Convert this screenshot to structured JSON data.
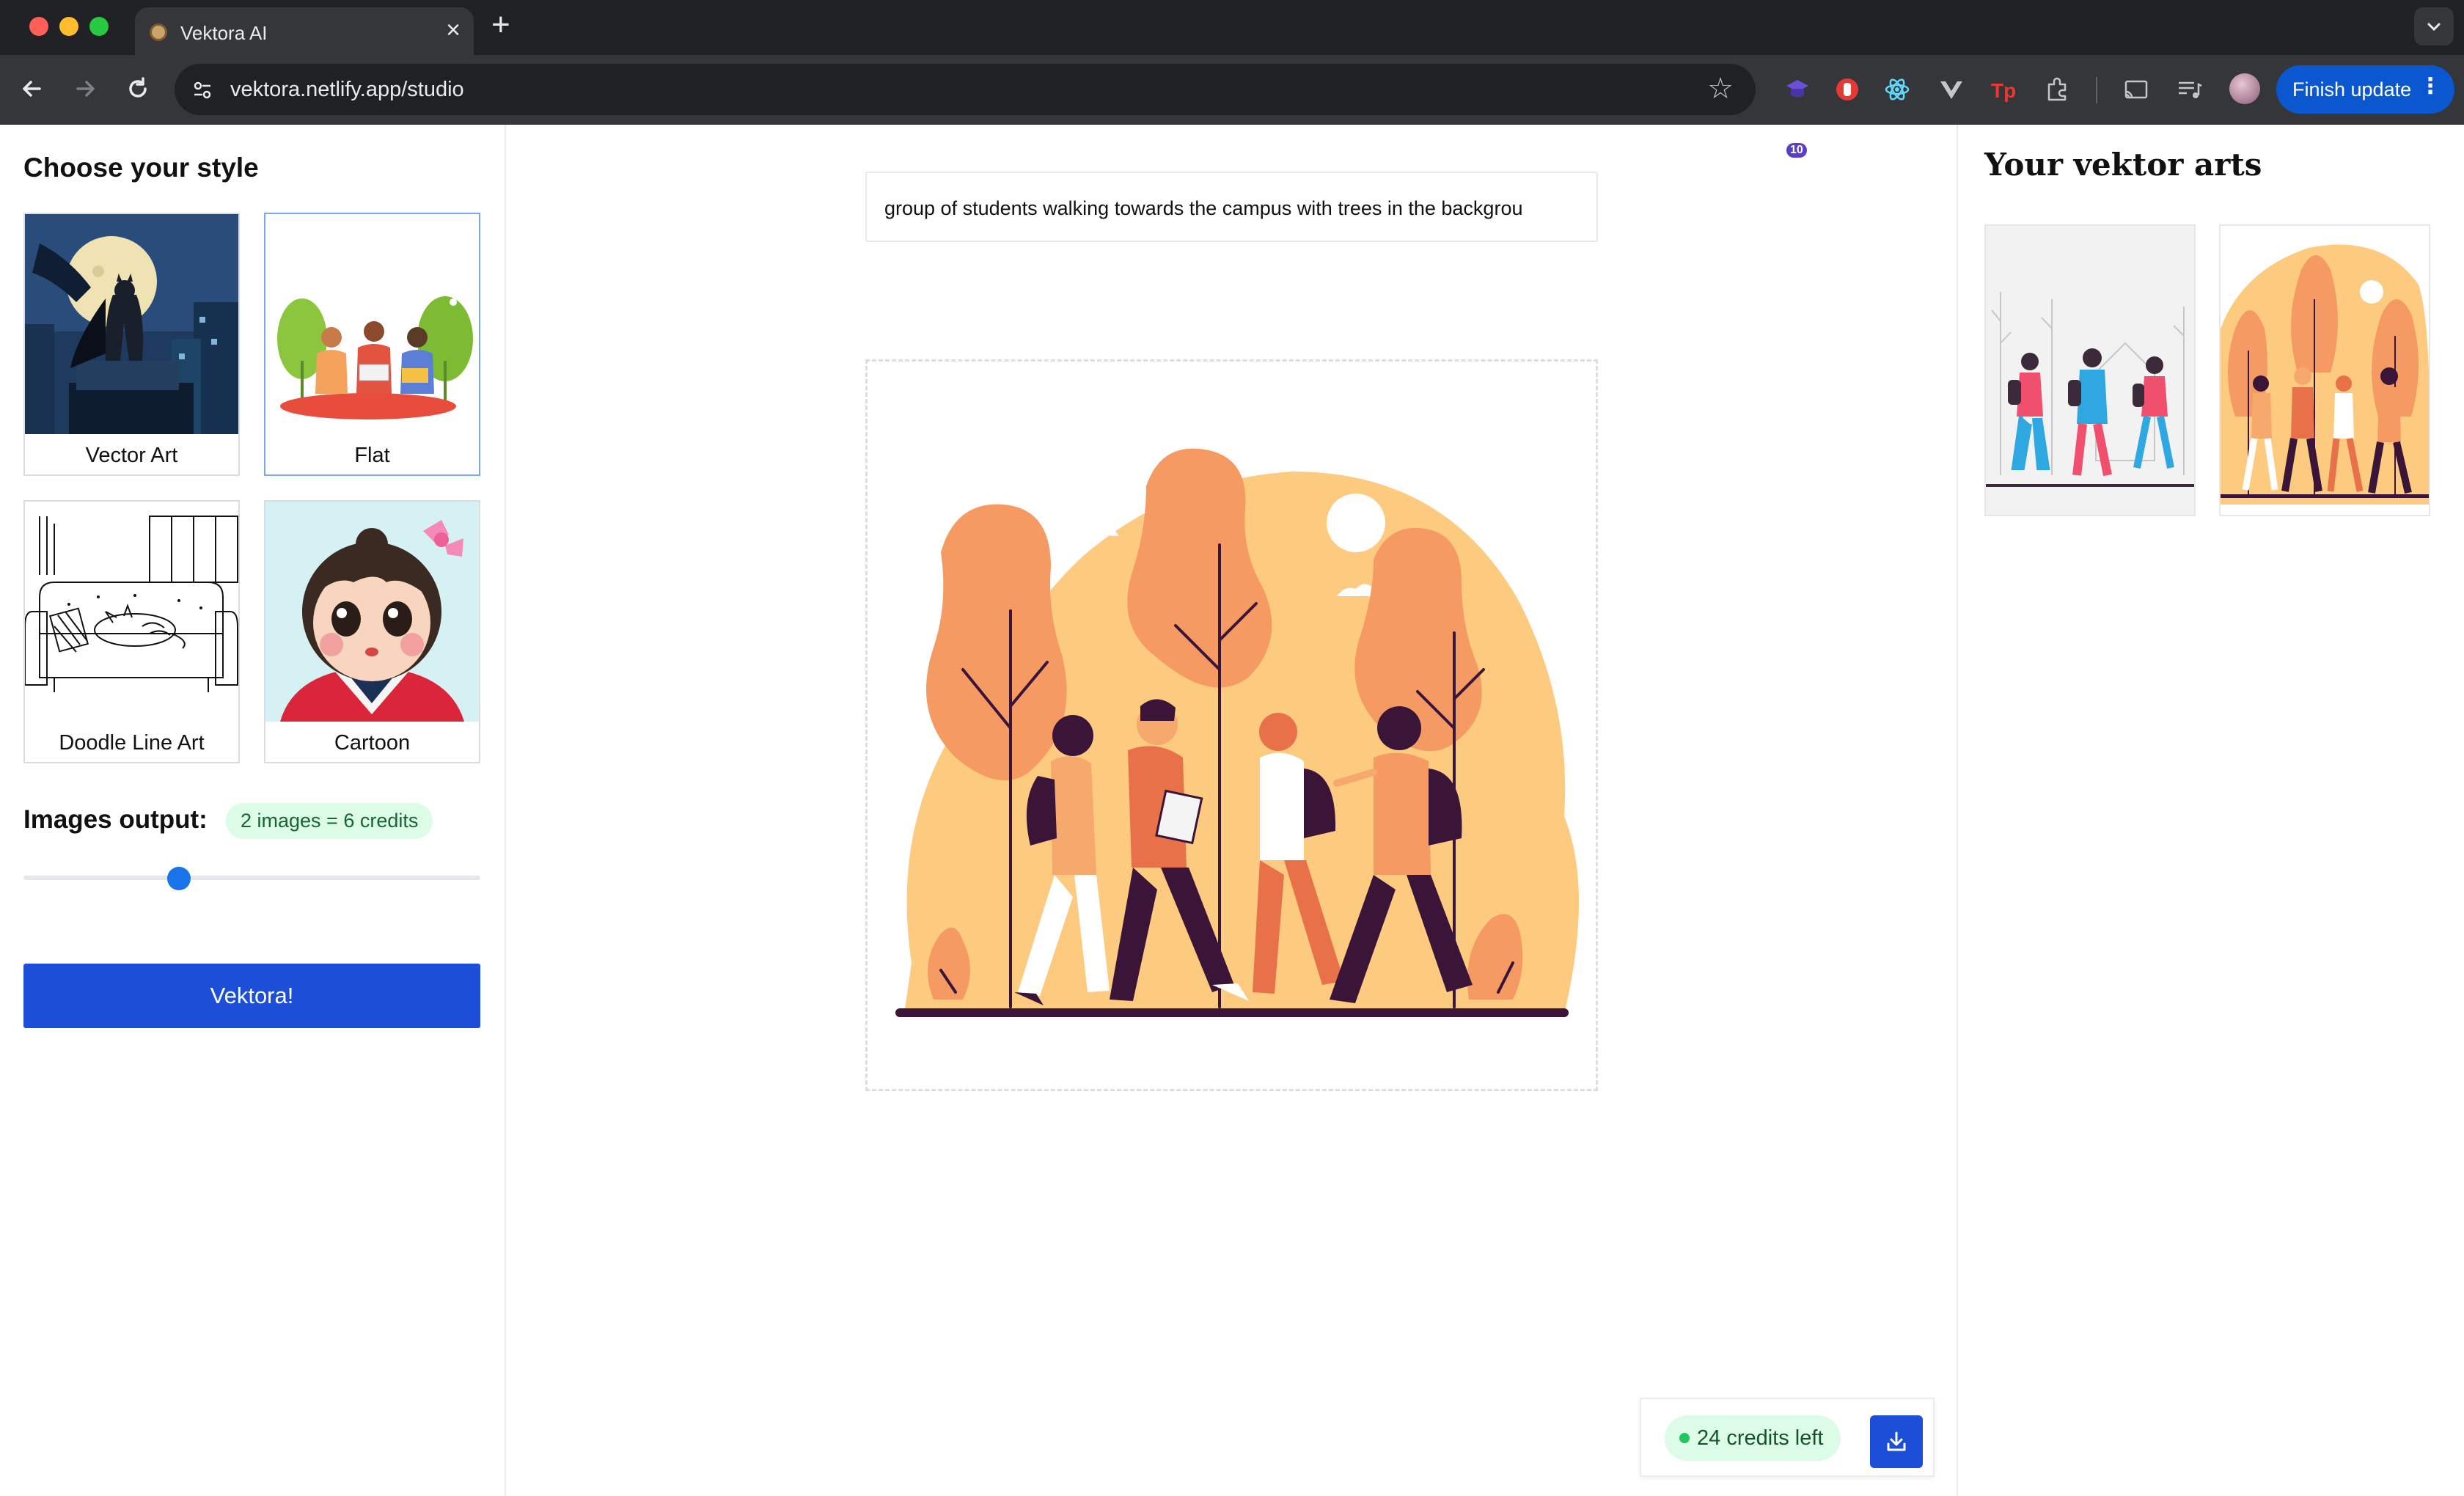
{
  "browser": {
    "tab_title": "Vektora AI",
    "url": "vektora.netlify.app/studio",
    "extension_badge": "10",
    "finish_update_label": "Finish update"
  },
  "left_panel": {
    "title": "Choose your style",
    "styles": [
      {
        "label": "Vector Art",
        "selected": false
      },
      {
        "label": "Flat",
        "selected": true
      },
      {
        "label": "Doodle Line Art",
        "selected": false
      },
      {
        "label": "Cartoon",
        "selected": false
      }
    ],
    "images_output_label": "Images output:",
    "credit_info": "2 images = 6 credits",
    "slider_value_fraction": 0.34,
    "generate_button": "Vektora!"
  },
  "center": {
    "prompt_value": "group of students walking towards the campus with trees in the backgrou"
  },
  "right_panel": {
    "title": "Your vektor arts",
    "thumbnails_count": 2
  },
  "status": {
    "credits_left": "24 credits left"
  },
  "colors": {
    "primary_button": "#1d4ed8",
    "browser_accent": "#0b57d0",
    "credits_bg": "#dcfce7",
    "credits_text": "#166534",
    "illustration_orange": "#f59a63",
    "illustration_peach": "#fccb80",
    "illustration_dark": "#3a1538"
  }
}
